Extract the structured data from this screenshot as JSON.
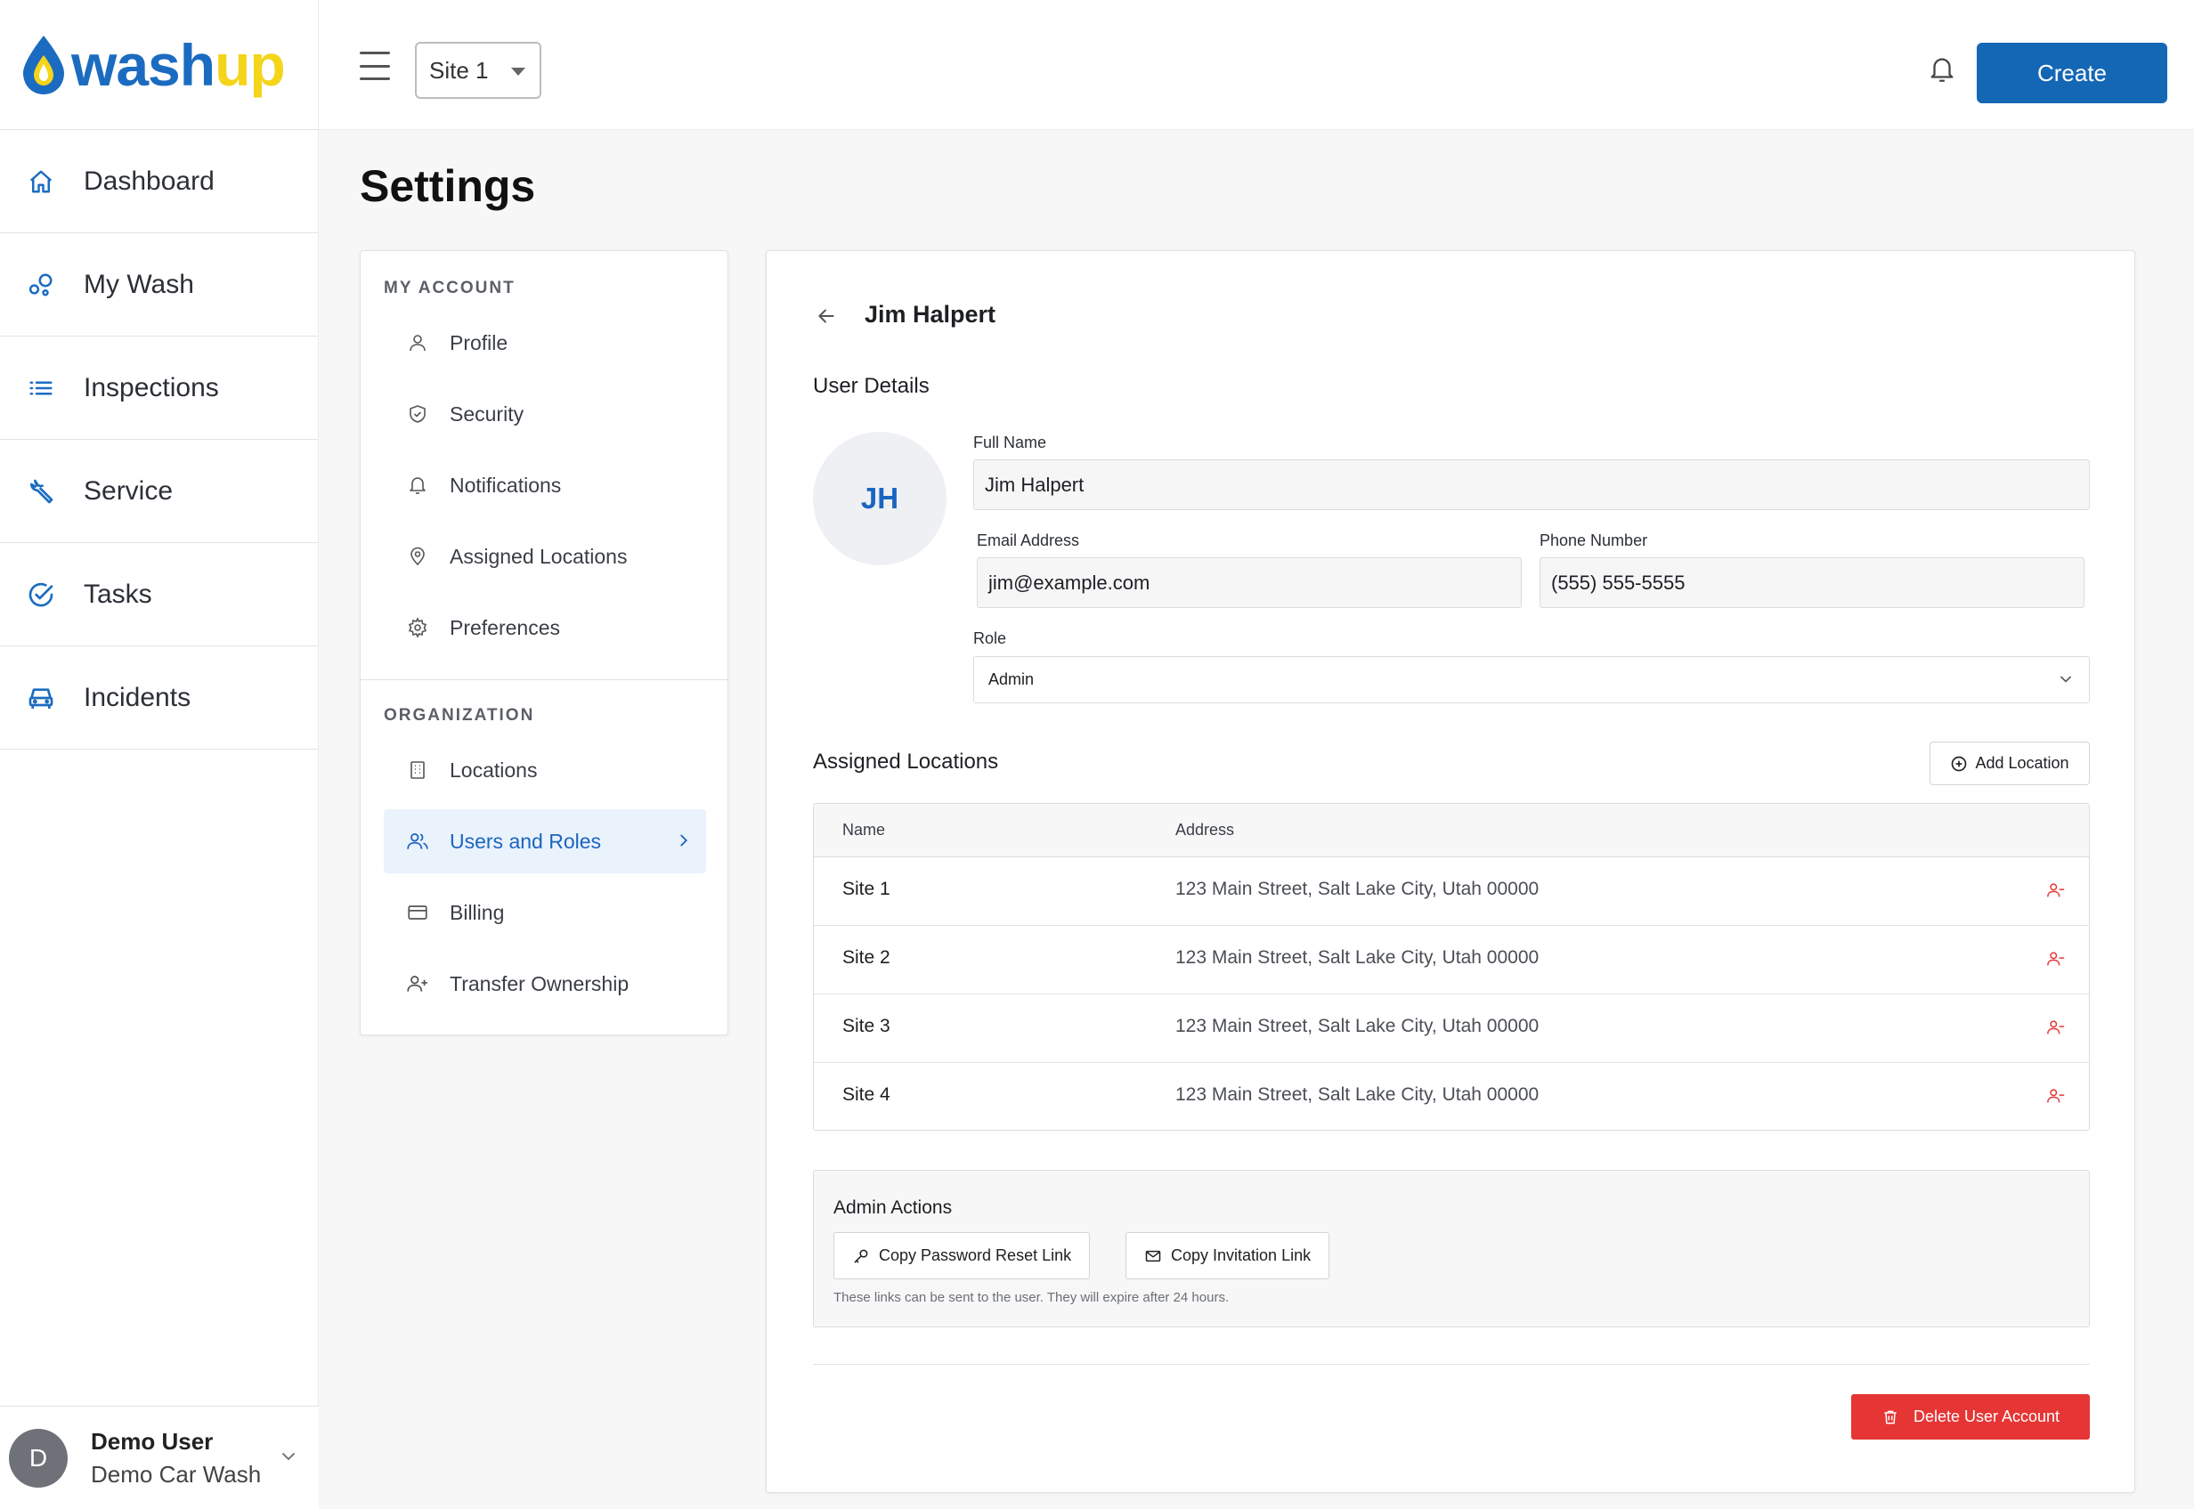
{
  "app": {
    "logo_wash": "wash",
    "logo_up": "up",
    "brand_blue": "#1b6cc0",
    "brand_yellow": "#f4d51a"
  },
  "sidebar": {
    "items": [
      {
        "label": "Dashboard",
        "icon": "home-icon"
      },
      {
        "label": "My Wash",
        "icon": "bubbles-icon"
      },
      {
        "label": "Inspections",
        "icon": "list-icon"
      },
      {
        "label": "Service",
        "icon": "wrench-icon"
      },
      {
        "label": "Tasks",
        "icon": "check-circle-icon"
      },
      {
        "label": "Incidents",
        "icon": "car-icon"
      }
    ],
    "user": {
      "initial": "D",
      "name": "Demo User",
      "org": "Demo Car Wash"
    }
  },
  "topbar": {
    "site_selected": "Site 1",
    "create_label": "Create",
    "accent": "#1467b5"
  },
  "page": {
    "title": "Settings"
  },
  "settings_menu": {
    "my_account_heading": "MY ACCOUNT",
    "my_account_items": [
      {
        "label": "Profile",
        "icon": "user-icon"
      },
      {
        "label": "Security",
        "icon": "shield-check-icon"
      },
      {
        "label": "Notifications",
        "icon": "bell-icon"
      },
      {
        "label": "Assigned Locations",
        "icon": "map-pin-icon"
      },
      {
        "label": "Preferences",
        "icon": "gear-icon"
      }
    ],
    "organization_heading": "ORGANIZATION",
    "organization_items": [
      {
        "label": "Locations",
        "icon": "building-icon"
      },
      {
        "label": "Users and Roles",
        "icon": "users-icon",
        "active": true
      },
      {
        "label": "Billing",
        "icon": "credit-card-icon"
      },
      {
        "label": "Transfer Ownership",
        "icon": "user-plus-icon"
      }
    ]
  },
  "user_detail": {
    "name_title": "Jim Halpert",
    "details_heading": "User Details",
    "initials": "JH",
    "full_name_label": "Full Name",
    "full_name_value": "Jim Halpert",
    "email_label": "Email Address",
    "email_value": "jim@example.com",
    "phone_label": "Phone Number",
    "phone_value": "(555) 555-5555",
    "role_label": "Role",
    "role_value": "Admin"
  },
  "assigned_locations": {
    "heading": "Assigned Locations",
    "add_label": "Add Location",
    "columns": [
      "Name",
      "Address"
    ],
    "rows": [
      {
        "name": "Site 1",
        "address": "123 Main Street, Salt Lake City, Utah 00000"
      },
      {
        "name": "Site 2",
        "address": "123 Main Street, Salt Lake City, Utah 00000"
      },
      {
        "name": "Site 3",
        "address": "123 Main Street, Salt Lake City, Utah 00000"
      },
      {
        "name": "Site 4",
        "address": "123 Main Street, Salt Lake City, Utah 00000"
      }
    ]
  },
  "admin_actions": {
    "heading": "Admin Actions",
    "reset_link_label": "Copy Password Reset Link",
    "invite_link_label": "Copy Invitation Link",
    "note": "These links can be sent to the user. They will expire after 24 hours."
  },
  "danger": {
    "delete_label": "Delete User Account",
    "color": "#e63535"
  }
}
